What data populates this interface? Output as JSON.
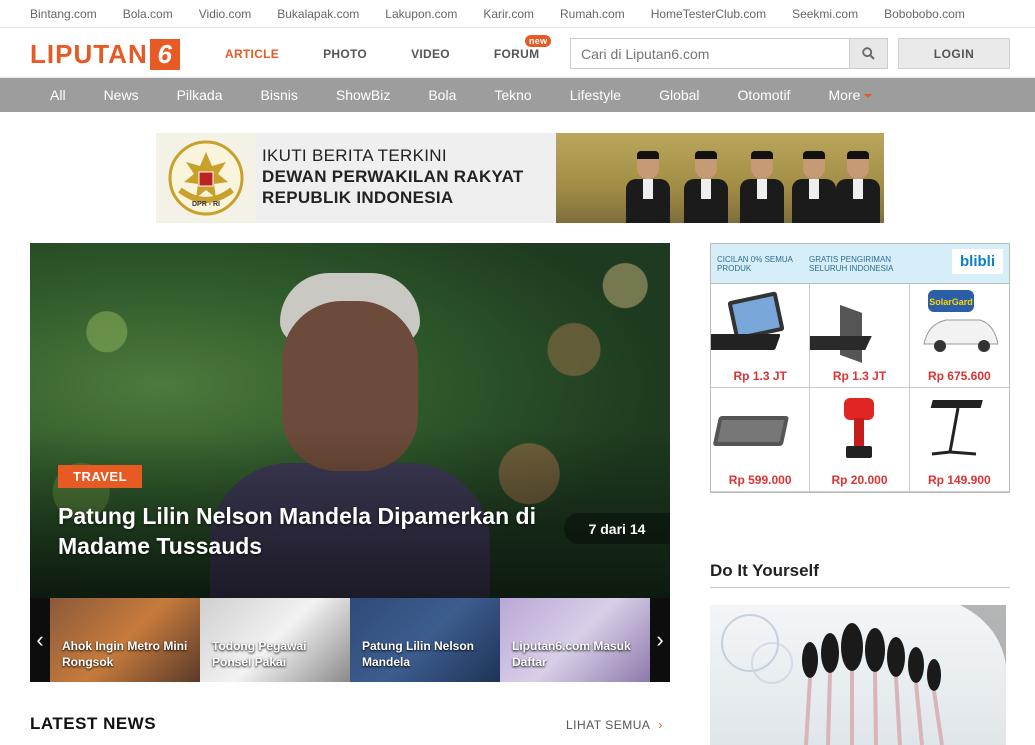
{
  "network_links": [
    "Bintang.com",
    "Bola.com",
    "Vidio.com",
    "Bukalapak.com",
    "Lakupon.com",
    "Karir.com",
    "Rumah.com",
    "HomeTesterClub.com",
    "Seekmi.com",
    "Bobobobo.com"
  ],
  "logo": {
    "word": "LIPUTAN",
    "number": "6"
  },
  "main_nav": {
    "article": "ARTICLE",
    "photo": "PHOTO",
    "video": "VIDEO",
    "forum": "FORUM",
    "forum_badge": "new"
  },
  "search": {
    "placeholder": "Cari di Liputan6.com"
  },
  "login_label": "LOGIN",
  "categories": [
    "All",
    "News",
    "Pilkada",
    "Bisnis",
    "ShowBiz",
    "Bola",
    "Tekno",
    "Lifestyle",
    "Global",
    "Otomotif",
    "More"
  ],
  "banner": {
    "seal_text": "DPR - RI",
    "line1": "IKUTI BERITA TERKINI",
    "line2": "DEWAN PERWAKILAN RAKYAT",
    "line3": "REPUBLIK INDONESIA"
  },
  "hero": {
    "tag": "TRAVEL",
    "headline": "Patung Lilin Nelson Mandela Dipamerkan di Madame Tussauds",
    "counter": "7 dari 14"
  },
  "thumbnails": [
    "Ahok Ingin Metro Mini Rongsok",
    "Todong Pegawai Ponsel Pakai",
    "Patung Lilin Nelson Mandela",
    "Liputan6.com Masuk Daftar"
  ],
  "side_ad": {
    "promo1": "CICILAN 0% SEMUA PRODUK",
    "promo2": "GRATIS PENGIRIMAN SELURUH INDONESIA",
    "brand": "blibli",
    "prices": [
      "Rp 1.3 JT",
      "Rp 1.3 JT",
      "Rp 675.600",
      "Rp 599.000",
      "Rp 20.000",
      "Rp 149.900"
    ]
  },
  "diy": {
    "title": "Do It Yourself"
  },
  "latest": {
    "title": "LATEST NEWS",
    "see_all": "LIHAT SEMUA"
  },
  "colors": {
    "accent": "#e85a24",
    "category_bar": "#9d9d9d"
  }
}
